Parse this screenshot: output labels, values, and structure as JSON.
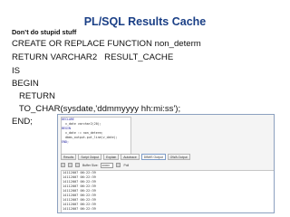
{
  "slide": {
    "title": "PL/SQL Results Cache",
    "subtitle": "Don’t do stupid stuff",
    "code_lines": [
      "CREATE OR REPLACE FUNCTION non_determ",
      "RETURN VARCHAR2   RESULT_CACHE",
      "IS",
      "BEGIN",
      "   RETURN",
      "   TO_CHAR(sysdate,'ddmmyyyy hh:mi:ss');",
      "END;"
    ]
  },
  "screenshot": {
    "editor_lines": [
      "DECLARE",
      "  v_date varchar2(20);",
      "BEGIN",
      "  v_date := non_determ;",
      "  dbms_output.put_line(v_date);",
      "END;"
    ],
    "tabs": [
      "Results",
      "Script Output",
      "Explain",
      "Autotrace",
      "DBMS Output",
      "OWA Output"
    ],
    "buffer_size_label": "Buffer Size:",
    "buffer_size_value": "20000",
    "poll_label": "Poll",
    "result_rows": [
      "14112007 06:22:39",
      "14112007 06:22:39",
      "14112007 06:22:39",
      "14112007 06:22:39",
      "14112007 06:22:39",
      "14112007 06:22:39",
      "14112007 06:22:39",
      "14112007 06:22:39",
      "14112007 06:22:39"
    ]
  }
}
